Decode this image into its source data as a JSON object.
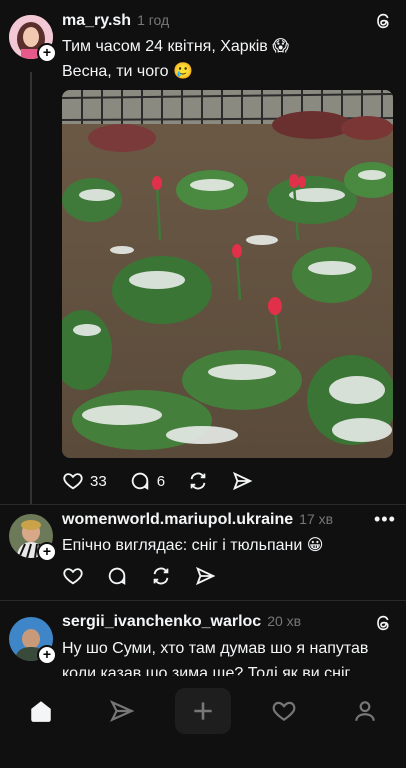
{
  "posts": [
    {
      "username": "ma_ry.sh",
      "time": "1 год",
      "lines": [
        "Тим часом 24 квітня, Харків 😱",
        "Весна, ти чого 🥲"
      ],
      "likes": "33",
      "comments": "6"
    },
    {
      "username": "womenworld.mariupol.ukraine",
      "time": "17 хв",
      "lines": [
        "Епічно виглядає: сніг і тюльпани 😀"
      ]
    },
    {
      "username": "sergii_ivanchenko_warloc",
      "time": "20 хв",
      "lines": [
        "Ну шо Суми, хто там думав шо я напутав",
        "коли казав шо зима ще? Тоді як ви сніг"
      ]
    }
  ],
  "icons": {
    "threads": "threads-logo-icon",
    "like": "heart-icon",
    "comment": "comment-icon",
    "repost": "repost-icon",
    "share": "share-icon",
    "more": "more-icon"
  },
  "nav": [
    "home-icon",
    "send-icon",
    "plus-icon",
    "heart-icon",
    "profile-icon"
  ],
  "colors": {
    "background": "#101010",
    "muted": "#777777",
    "text": "#f3f5f7"
  }
}
